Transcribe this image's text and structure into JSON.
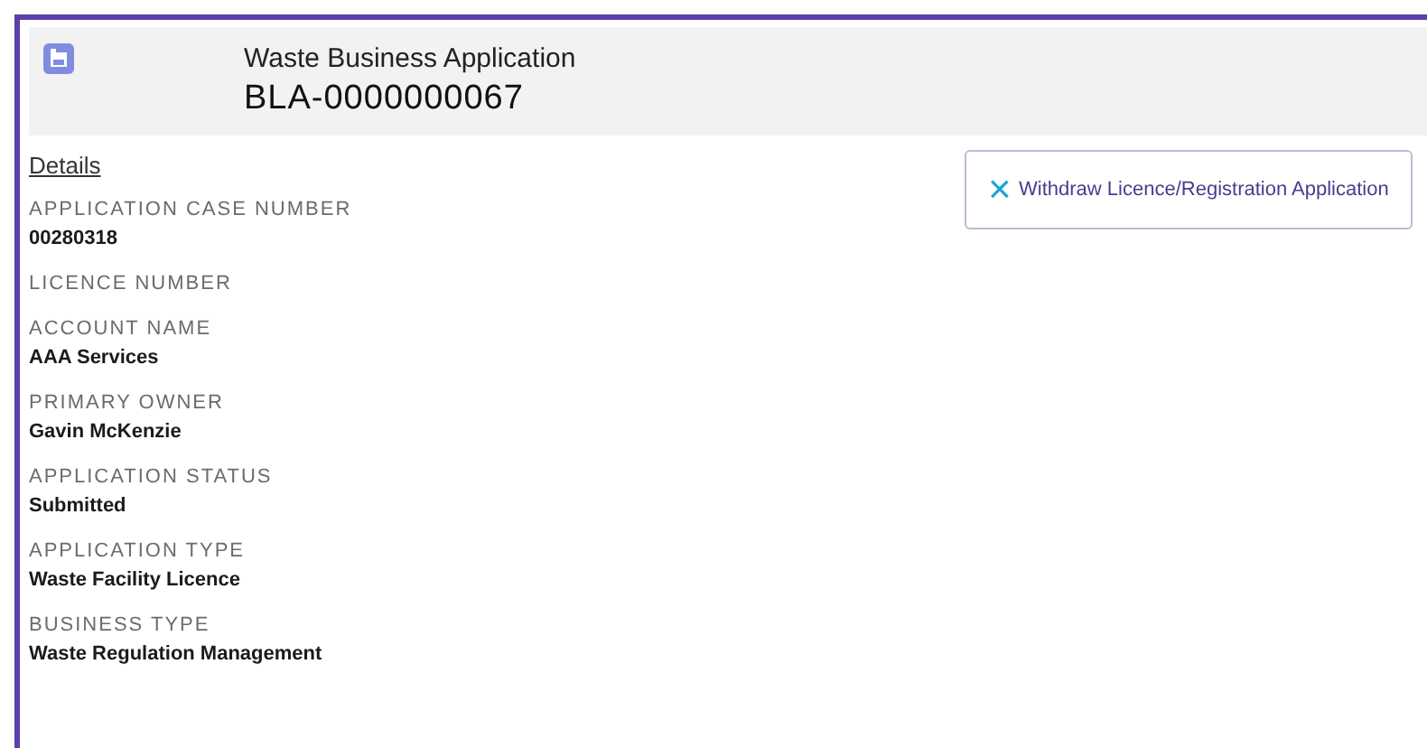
{
  "header": {
    "object_type": "Waste Business Application",
    "record_name": "BLA-0000000067"
  },
  "tab": {
    "label": "Details"
  },
  "action_button": {
    "icon": "×",
    "label": "Withdraw Licence/Registration Application"
  },
  "fields": [
    {
      "label": "APPLICATION CASE NUMBER",
      "value": "00280318"
    },
    {
      "label": "LICENCE NUMBER"
    },
    {
      "label": "ACCOUNT NAME",
      "value": "AAA Services"
    },
    {
      "label": "PRIMARY OWNER",
      "value": "Gavin McKenzie"
    },
    {
      "label": "APPLICATION STATUS",
      "value": "Submitted"
    },
    {
      "label": "APPLICATION TYPE",
      "value": "Waste Facility Licence"
    },
    {
      "label": "BUSINESS TYPE",
      "value": "Waste Regulation Management"
    }
  ]
}
